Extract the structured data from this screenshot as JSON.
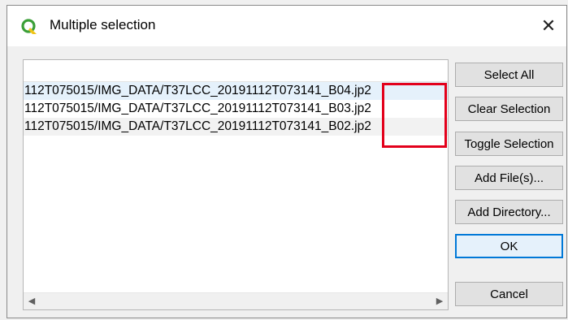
{
  "title": "Multiple selection",
  "close_glyph": "✕",
  "list": {
    "rows": [
      {
        "text": "112T075015/IMG_DATA/T37LCC_20191112T073141_B04.jp2",
        "state": "selected"
      },
      {
        "text": "112T075015/IMG_DATA/T37LCC_20191112T073141_B03.jp2",
        "state": "normal"
      },
      {
        "text": "112T075015/IMG_DATA/T37LCC_20191112T073141_B02.jp2",
        "state": "alternate"
      }
    ],
    "scroll_left_glyph": "◀",
    "scroll_right_glyph": "▶"
  },
  "buttons": {
    "select_all": "Select All",
    "clear_selection": "Clear Selection",
    "toggle_selection": "Toggle Selection",
    "add_files": "Add File(s)...",
    "add_directory": "Add Directory...",
    "ok": "OK",
    "cancel": "Cancel"
  },
  "colors": {
    "accent": "#0078d7",
    "highlight_box": "#e3001b",
    "qgis_green": "#3a9f37",
    "qgis_yellow": "#f0c419"
  },
  "icons": {
    "app": "qgis-logo-icon",
    "close": "close-icon"
  }
}
